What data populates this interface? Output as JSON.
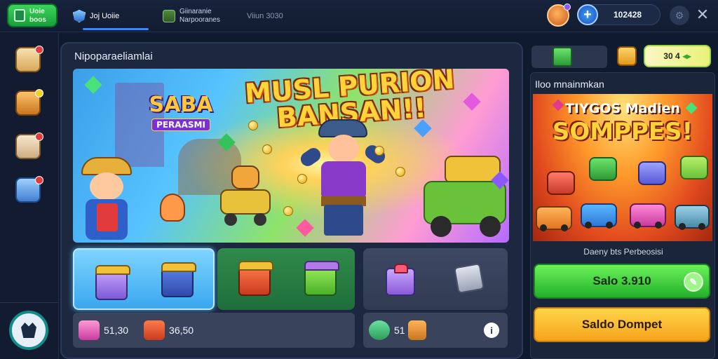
{
  "topbar": {
    "logo_text": "Uoie boos",
    "tabs": [
      {
        "label": "Joj Uoiie",
        "icon": "shield-icon"
      },
      {
        "label_line1": "Giinaranie",
        "label_line2": "Narpooranes",
        "icon": "cube-icon"
      },
      {
        "label": "Viiun 3030"
      }
    ],
    "currency_amount": "102428"
  },
  "main": {
    "title": "Nipoparaeliamlai",
    "hero": {
      "title_line1": "MUSL PURION",
      "title_line2": "BANSAN!!",
      "logo_line1": "SABA",
      "logo_line2": "PERAASMI"
    },
    "price_rows": [
      {
        "price_a": "51,30",
        "price_b": "36,50"
      },
      {
        "price_a": "51"
      }
    ]
  },
  "right": {
    "counter_value": "30 4",
    "panel_title": "Iloo mnainmkan",
    "promo_line1": "TIYGOS Madien",
    "promo_line2": "SOMPPES!",
    "caption": "Daeny bts Perbeosisi",
    "green_button_label": "Salo 3.910",
    "yellow_button_label": "Saldo Dompet"
  },
  "colors": {
    "background": "#101a2e",
    "accent_blue": "#3a86ff",
    "green_button": "#22b02a",
    "yellow_button": "#f5a31b"
  }
}
